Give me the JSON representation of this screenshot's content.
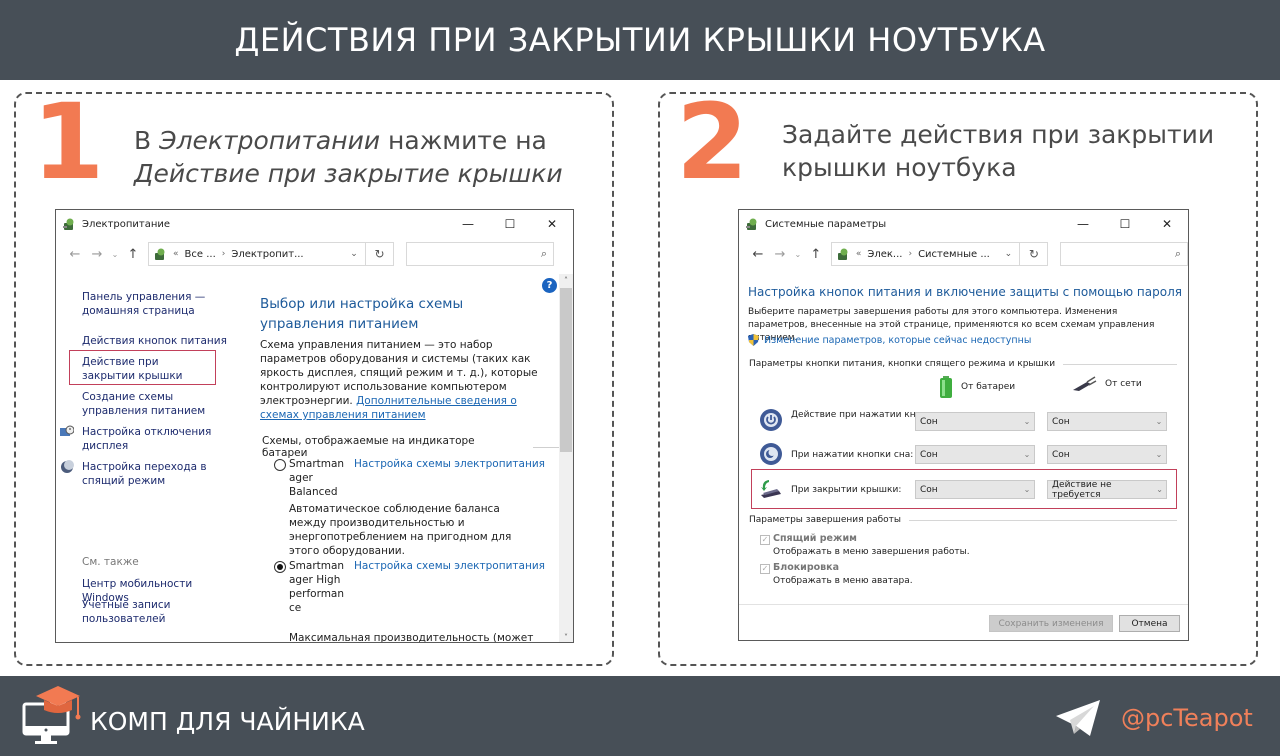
{
  "header": {
    "title": "ДЕЙСТВИЯ ПРИ ЗАКРЫТИИ КРЫШКИ НОУТБУКА"
  },
  "colors": {
    "accent": "#f27a52",
    "bar": "#474f57",
    "link": "#1a66b3",
    "highlight": "#c2405a"
  },
  "step1": {
    "number": "1",
    "text_prefix": "В ",
    "text_italic_1": "Электропитании",
    "text_mid": " нажмите на",
    "text_italic_2": "Действие при закрытие крышки",
    "window": {
      "title": "Электропитание",
      "icon": "power-options-icon",
      "controls": {
        "minimize": "—",
        "maximize": "☐",
        "close": "✕"
      },
      "nav": {
        "back": "←",
        "forward": "→",
        "recent": "⌄",
        "up": "↑"
      },
      "address": {
        "prefix": "«",
        "crumbs": [
          "Все ...",
          "Электропит..."
        ]
      },
      "search_placeholder": "",
      "sidebar": {
        "links": [
          "Панель управления — домашняя страница",
          "Действия кнопок питания",
          "Действие при закрытии крышки",
          "Создание схемы управления питанием",
          "Настройка отключения дисплея",
          "Настройка перехода в спящий режим"
        ],
        "see_also_label": "См. также",
        "see_also": [
          "Центр мобильности Windows",
          "Учетные записи пользователей"
        ]
      },
      "main": {
        "title": "Выбор или настройка схемы управления питанием",
        "description": "Схема управления питанием — это набор параметров оборудования и системы (таких как яркость дисплея, спящий режим и т. д.), которые контролируют использование компьютером электроэнергии.",
        "more_link": "Дополнительные сведения о схемах управления питанием",
        "section_label": "Схемы, отображаемые на индикаторе батареи",
        "plans": [
          {
            "name": "Smartman ager Balanced",
            "selected": false,
            "link": "Настройка схемы электропитания",
            "description": "Автоматическое соблюдение баланса между производительностью и энергопотреблением на пригодном для этого оборудовании."
          },
          {
            "name": "Smartman ager High performan ce",
            "selected": true,
            "link": "Настройка схемы электропитания",
            "description": "Максимальная производительность (может"
          }
        ]
      }
    }
  },
  "step2": {
    "number": "2",
    "text": "Задайте действия при закрытии крышки ноутбука",
    "window": {
      "title": "Системные параметры",
      "controls": {
        "minimize": "—",
        "maximize": "☐",
        "close": "✕"
      },
      "nav": {
        "back": "←",
        "forward": "→",
        "recent": "⌄",
        "up": "↑"
      },
      "address": {
        "prefix": "«",
        "crumbs": [
          "Элек...",
          "Системные ..."
        ]
      },
      "heading": "Настройка кнопок питания и включение защиты с помощью пароля",
      "description": "Выберите параметры завершения работы для этого компьютера. Изменения параметров, внесенные на этой странице, применяются ко всем схемам управления питанием.",
      "admin_link": "Изменение параметров, которые сейчас недоступны",
      "section1": "Параметры кнопки питания, кнопки спящего режима и крышки",
      "columns": {
        "battery": "От батареи",
        "plugged": "От сети"
      },
      "rows": [
        {
          "label": "Действие при нажатии кнопки питания:",
          "battery": "Сон",
          "plugged": "Сон",
          "icon": "power-button-icon"
        },
        {
          "label": "При нажатии кнопки сна:",
          "battery": "Сон",
          "plugged": "Сон",
          "icon": "sleep-button-icon"
        },
        {
          "label": "При закрытии крышки:",
          "battery": "Сон",
          "plugged": "Действие не требуется",
          "icon": "laptop-lid-icon"
        }
      ],
      "section2": "Параметры завершения работы",
      "checkboxes": [
        {
          "label": "Спящий режим",
          "description": "Отображать в меню завершения работы.",
          "checked": true,
          "disabled": true
        },
        {
          "label": "Блокировка",
          "description": "Отображать в меню аватара.",
          "checked": true,
          "disabled": true
        }
      ],
      "buttons": {
        "save": "Сохранить изменения",
        "cancel": "Отмена"
      }
    }
  },
  "footer": {
    "brand": "КОМП ДЛЯ ЧАЙНИКА",
    "handle": "@pcTeapot"
  }
}
